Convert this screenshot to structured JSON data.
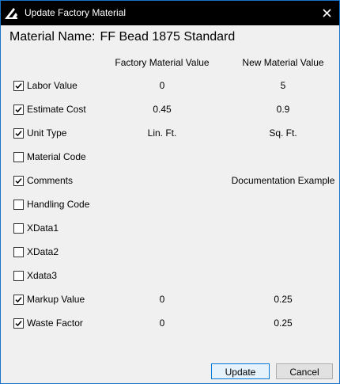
{
  "window": {
    "title": "Update Factory Material",
    "accent_color": "#1a73c8",
    "titlebar_color": "#000000",
    "app_icon": "triangle-logo-icon",
    "close_icon": "close-icon"
  },
  "material": {
    "label": "Material Name:",
    "value": "FF Bead 1875 Standard"
  },
  "columns": {
    "factory": "Factory Material Value",
    "new": "New Material Value"
  },
  "rows": [
    {
      "label": "Labor Value",
      "checked": true,
      "factory": "0",
      "new": "5"
    },
    {
      "label": "Estimate Cost",
      "checked": true,
      "factory": "0.45",
      "new": "0.9"
    },
    {
      "label": "Unit Type",
      "checked": true,
      "factory": "Lin. Ft.",
      "new": "Sq. Ft."
    },
    {
      "label": "Material Code",
      "checked": false,
      "factory": "",
      "new": ""
    },
    {
      "label": "Comments",
      "checked": true,
      "factory": "",
      "new": "Documentation Example"
    },
    {
      "label": "Handling Code",
      "checked": false,
      "factory": "",
      "new": ""
    },
    {
      "label": "XData1",
      "checked": false,
      "factory": "",
      "new": ""
    },
    {
      "label": "XData2",
      "checked": false,
      "factory": "",
      "new": ""
    },
    {
      "label": "Xdata3",
      "checked": false,
      "factory": "",
      "new": ""
    },
    {
      "label": "Markup Value",
      "checked": true,
      "factory": "0",
      "new": "0.25"
    },
    {
      "label": "Waste Factor",
      "checked": true,
      "factory": "0",
      "new": "0.25"
    }
  ],
  "buttons": {
    "update": "Update",
    "cancel": "Cancel"
  }
}
